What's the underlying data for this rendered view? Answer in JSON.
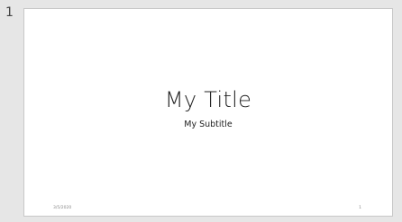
{
  "slide_panel": {
    "slide_number": "1",
    "slide": {
      "title": "My Title",
      "subtitle": "My Subtitle",
      "date": "3/5/2020",
      "footer_slide_number": "1"
    }
  }
}
